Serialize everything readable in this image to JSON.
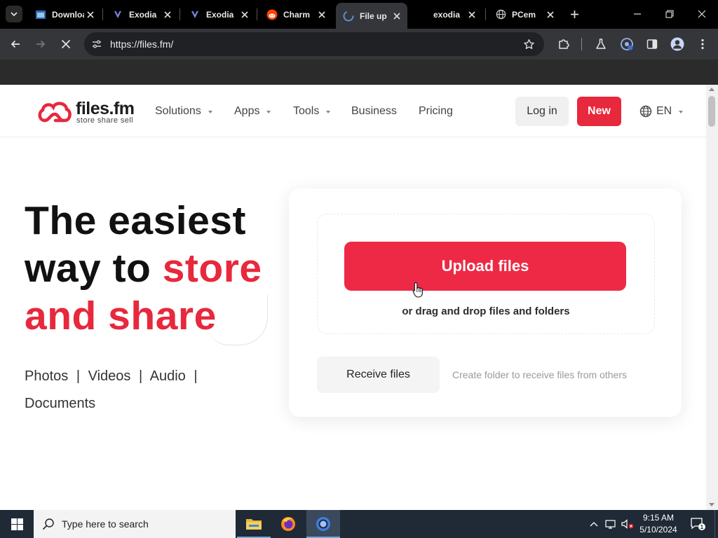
{
  "browser": {
    "tabs": [
      {
        "title": "Download",
        "favicon": "window-app-icon",
        "active": false
      },
      {
        "title": "Exodia",
        "favicon": "exodia-logo-icon",
        "active": false
      },
      {
        "title": "Exodia",
        "favicon": "exodia-logo-icon",
        "active": false
      },
      {
        "title": "Charm",
        "favicon": "reddit-icon",
        "active": false
      },
      {
        "title": "File up",
        "favicon": "files-fm-icon",
        "active": true
      },
      {
        "title": "exodia",
        "favicon": "none",
        "active": false
      },
      {
        "title": "PCem",
        "favicon": "globe-icon",
        "active": false
      }
    ],
    "url": "https://files.fm/"
  },
  "site": {
    "logo": {
      "name": "files.fm",
      "tagline": "store  share  sell"
    },
    "nav": [
      {
        "label": "Solutions",
        "dropdown": true
      },
      {
        "label": "Apps",
        "dropdown": true
      },
      {
        "label": "Tools",
        "dropdown": true
      },
      {
        "label": "Business",
        "dropdown": false
      },
      {
        "label": "Pricing",
        "dropdown": false
      }
    ],
    "login_label": "Log in",
    "new_label": "New",
    "language": "EN",
    "accent_color": "#e8283c"
  },
  "hero": {
    "line1": "The easiest",
    "line2_plain": "way to ",
    "line2_highlight": "store",
    "line3_highlight": "and share",
    "media_types": [
      "Photos",
      "Videos",
      "Audio",
      "Documents"
    ],
    "separator": "|"
  },
  "upload": {
    "button_label": "Upload files",
    "drag_hint": "or drag and drop files and folders",
    "receive_label": "Receive files",
    "receive_hint": "Create folder to receive files from others"
  },
  "taskbar": {
    "search_placeholder": "Type here to search",
    "time": "9:15 AM",
    "date": "5/10/2024",
    "notification_count": "1"
  }
}
